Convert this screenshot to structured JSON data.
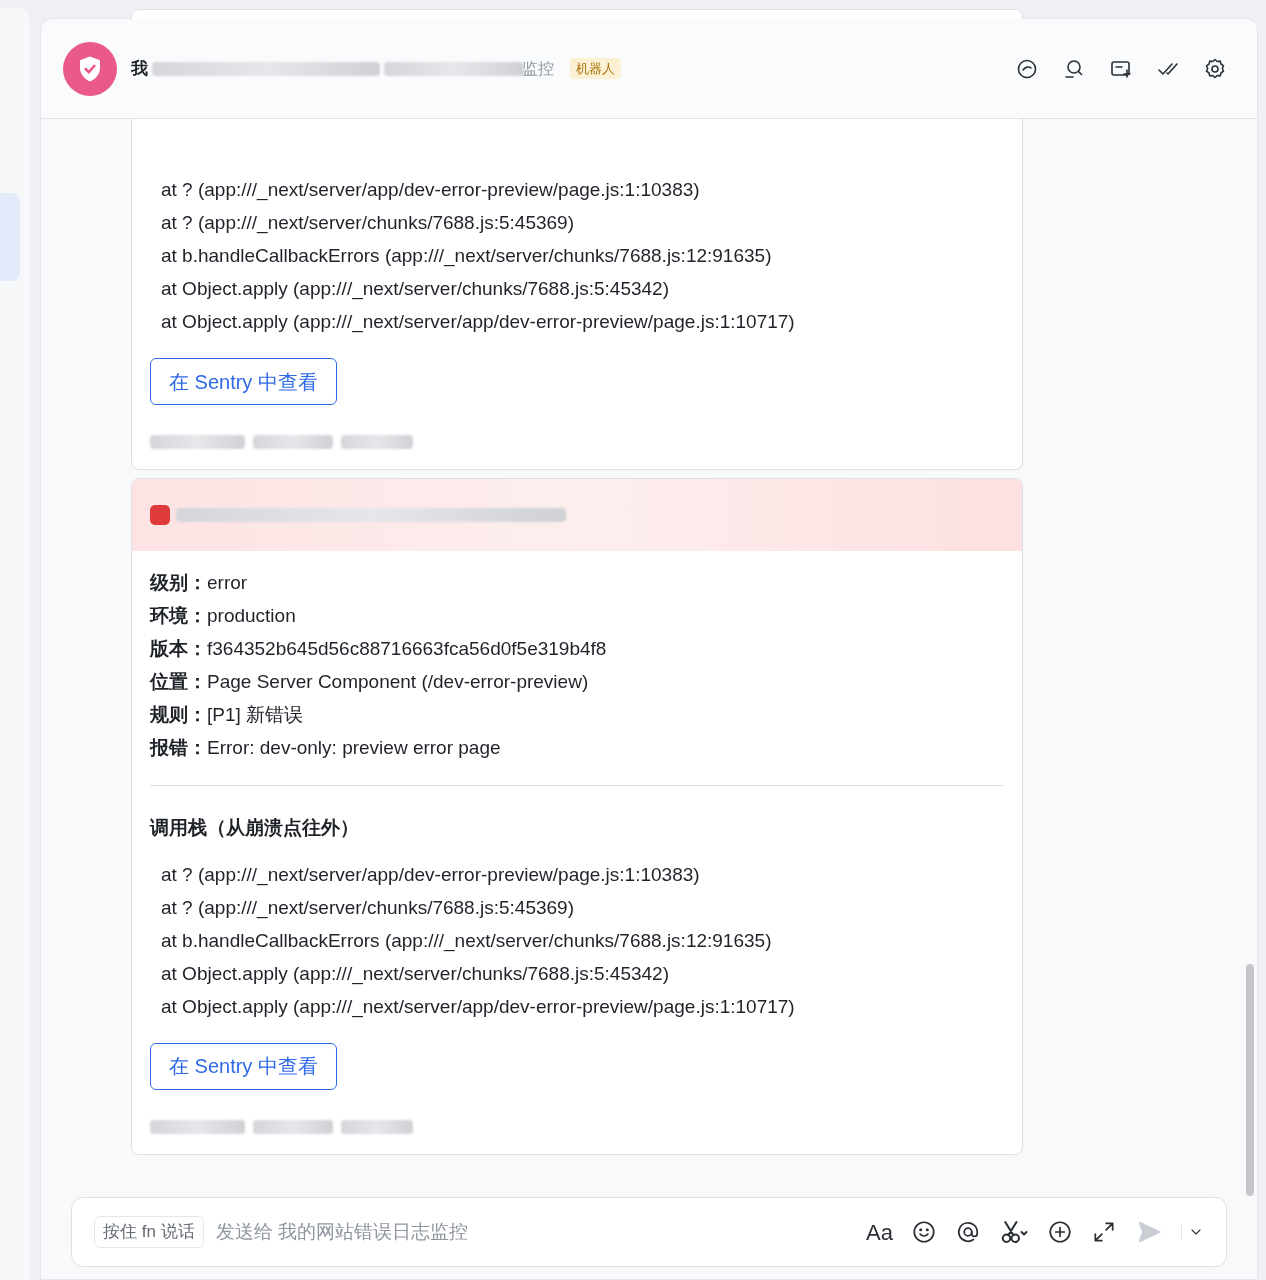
{
  "header": {
    "title_start": "我",
    "title_end": "监控",
    "badge": "机器人"
  },
  "messages": [
    {
      "kind": "continued",
      "stack_lines": [
        "at ? (app:///_next/server/app/dev-error-preview/page.js:1:10383)",
        "at ? (app:///_next/server/chunks/7688.js:5:45369)",
        "at b.handleCallbackErrors (app:///_next/server/chunks/7688.js:12:91635)",
        "at Object.apply (app:///_next/server/chunks/7688.js:5:45342)",
        "at Object.apply (app:///_next/server/app/dev-error-preview/page.js:1:10717)"
      ],
      "button": "在 Sentry 中查看"
    },
    {
      "kind": "alert",
      "fields": [
        {
          "label": "级别：",
          "value": "error"
        },
        {
          "label": "环境：",
          "value": "production"
        },
        {
          "label": "版本：",
          "value": "f364352b645d56c88716663fca56d0f5e319b4f8"
        },
        {
          "label": "位置：",
          "value": "Page Server Component (/dev-error-preview)"
        },
        {
          "label": "规则：",
          "value": "[P1] 新错误"
        },
        {
          "label": "报错：",
          "value": "Error: dev-only: preview error page"
        }
      ],
      "stack_title": "调用栈（从崩溃点往外）",
      "stack_lines": [
        "at ? (app:///_next/server/app/dev-error-preview/page.js:1:10383)",
        "at ? (app:///_next/server/chunks/7688.js:5:45369)",
        "at b.handleCallbackErrors (app:///_next/server/chunks/7688.js:12:91635)",
        "at Object.apply (app:///_next/server/chunks/7688.js:5:45342)",
        "at Object.apply (app:///_next/server/app/dev-error-preview/page.js:1:10717)"
      ],
      "button": "在 Sentry 中查看"
    }
  ],
  "composer": {
    "voice_hint": "按住 fn 说话",
    "placeholder": "发送给 我的网站错误日志监控",
    "format_label": "Aa"
  }
}
